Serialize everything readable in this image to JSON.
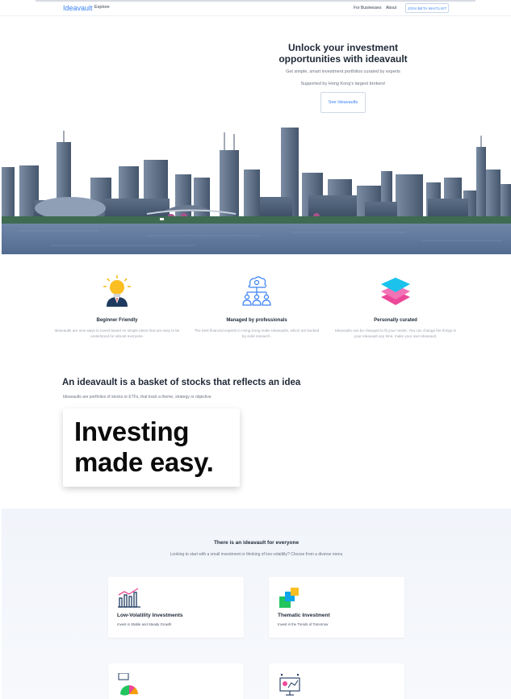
{
  "nav": {
    "brand": "Ideavault",
    "explore": "Explore",
    "for_businesses": "For Businesses",
    "about": "About",
    "cta": "JOIN BETA WAITLIST"
  },
  "hero": {
    "title": "Unlock your investment opportunities with ideavault",
    "subtitle": "Get simple, smart investment portfolios curated by experts",
    "supported": "Supported by Hong Kong's largest brokers!",
    "button": "See Ideavaults"
  },
  "features": [
    {
      "icon": "lightbulb-person-icon",
      "title": "Beginner Friendly",
      "desc": "Ideavaults are new ways to invest based on simple ideas that are easy to be understood for almost everyone."
    },
    {
      "icon": "team-network-icon",
      "title": "Managed by professionals",
      "desc": "The best financial experts in Hong Kong make Ideavaults, which are backed by solid research."
    },
    {
      "icon": "stacked-layers-icon",
      "title": "Personally curated",
      "desc": "Ideavaults can be changed to fit your needs. You can change the things in your Ideavault any time, make your own Ideavault."
    }
  ],
  "basket": {
    "title": "An ideavault is a basket of stocks that reflects an idea",
    "subtitle": "Ideavaults are portfolios of stocks or ETFs, that track a theme, strategy or objective",
    "promo": "Investing made easy."
  },
  "everyone": {
    "title": "There is an ideavault for everyone",
    "subtitle": "Looking to start with a small investment or thinking of low volatility? Choose from a diverse menu",
    "cards": [
      {
        "icon": "bar-chart-icon",
        "title": "Low-Volatility Investments",
        "sub": "Invest in Stable and Steady Growth"
      },
      {
        "icon": "puzzle-blocks-icon",
        "title": "Thematic Investment",
        "sub": "Invest in the Trends of Tomorrow"
      },
      {
        "icon": "pie-chart-icon",
        "title": "",
        "sub": ""
      },
      {
        "icon": "presentation-board-icon",
        "title": "",
        "sub": ""
      }
    ]
  },
  "colors": {
    "accent": "#3b82f6",
    "section_bg": "#f3f6fb"
  }
}
